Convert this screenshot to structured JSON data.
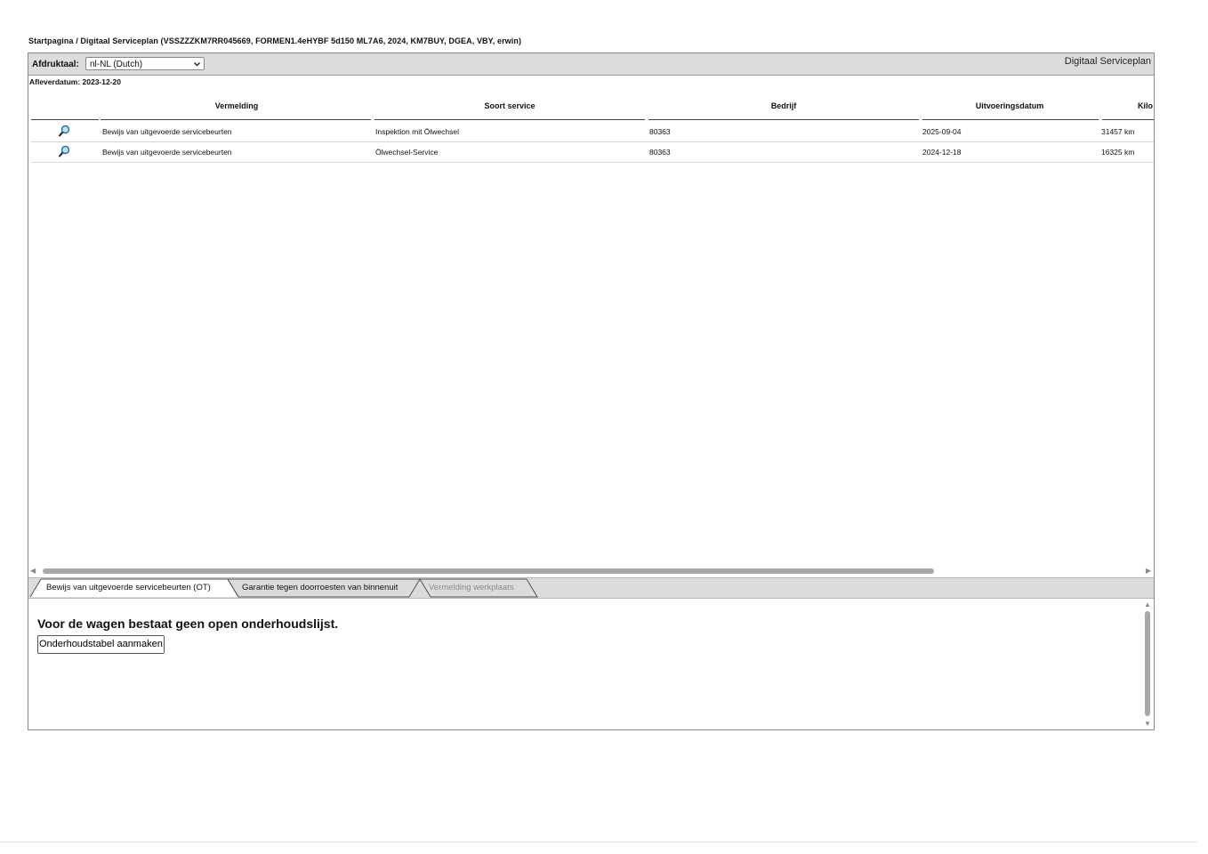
{
  "breadcrumb": "Startpagina / Digitaal Serviceplan (VSSZZZKM7RR045669, FORMEN1.4eHYBF 5d150 ML7A6, 2024, KM7BUY, DGEA, VBY, erwin)",
  "header": {
    "language_label": "Afdruktaal:",
    "language_value": "nl-NL (Dutch)",
    "app_title": "Digitaal Serviceplan"
  },
  "delivery_date": "Afleverdatum: 2023-12-20",
  "table": {
    "columns": [
      "Vermelding",
      "Soort service",
      "Bedrijf",
      "Uitvoeringsdatum",
      "Kilo"
    ],
    "rows": [
      {
        "entry": "Bewijs van uitgevoerde servicebeurten",
        "service_type": "Inspektion mit Ölwechsel",
        "company": "80363",
        "date": "2025-09-04",
        "km": "31457 km"
      },
      {
        "entry": "Bewijs van uitgevoerde servicebeurten",
        "service_type": "Ölwechsel-Service",
        "company": "80363",
        "date": "2024-12-18",
        "km": "16325 km"
      }
    ]
  },
  "tabs": [
    {
      "label": "Bewijs van uitgevoerde servicebeurten (OT)",
      "state": "active"
    },
    {
      "label": "Garantie tegen doorroesten van binnenuit",
      "state": "normal"
    },
    {
      "label": "Vermelding werkplaats",
      "state": "disabled"
    }
  ],
  "panel": {
    "message": "Voor de wagen bestaat geen open onderhoudslijst.",
    "button_label": "Onderhoudstabel aanmaken"
  },
  "icons": {
    "row_action": "magnifier-icon",
    "select_chevron": "chevron-down-icon"
  },
  "colors": {
    "header_bg": "#dddddd",
    "magnifier_lens": "#2f8fcf"
  }
}
